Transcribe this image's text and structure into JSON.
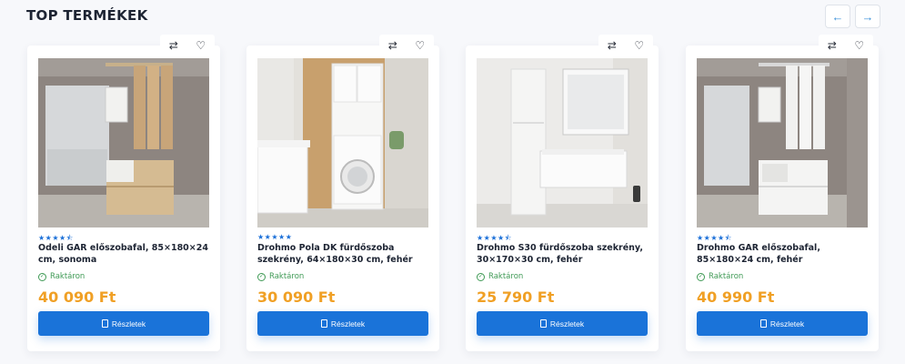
{
  "section": {
    "title": "TOP TERMÉKEK"
  },
  "nav": {
    "prev_icon": "arrow-left-icon",
    "next_icon": "arrow-right-icon"
  },
  "products": [
    {
      "name": "Odeli GAR előszobafal, 85×180×24 cm, sonoma",
      "rating": 4.5,
      "stars": "★★★★⯪",
      "stock": "Raktáron",
      "price": "40 090 Ft",
      "button": "Részletek",
      "image": "hallway-wall-sonoma"
    },
    {
      "name": "Drohmo Pola DK fürdőszoba szekrény, 64×180×30 cm, fehér",
      "rating": 5,
      "stars": "★★★★★",
      "stock": "Raktáron",
      "price": "30 090 Ft",
      "button": "Részletek",
      "image": "bathroom-cabinet-washer"
    },
    {
      "name": "Drohmo S30 fürdőszoba szekrény, 30×170×30 cm, fehér",
      "rating": 4.5,
      "stars": "★★★★⯪",
      "stock": "Raktáron",
      "price": "25 790 Ft",
      "button": "Részletek",
      "image": "bathroom-tall-cabinet"
    },
    {
      "name": "Drohmo GAR előszobafal, 85×180×24 cm, fehér",
      "rating": 4.5,
      "stars": "★★★★⯪",
      "stock": "Raktáron",
      "price": "40 990 Ft",
      "button": "Részletek",
      "image": "hallway-wall-white"
    }
  ],
  "icons": {
    "compare": "compare-icon",
    "wishlist": "heart-icon",
    "stock": "check-circle-icon",
    "details": "document-icon"
  }
}
